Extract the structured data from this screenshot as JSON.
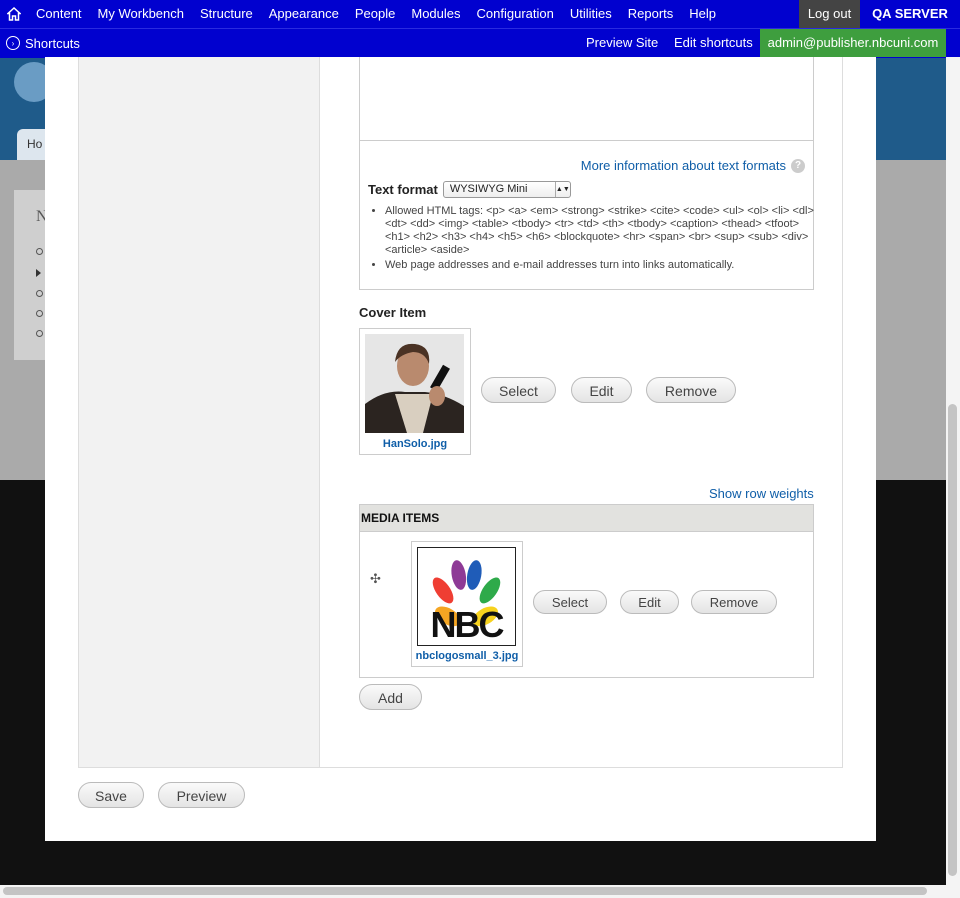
{
  "toolbar": {
    "nav": [
      "Content",
      "My Workbench",
      "Structure",
      "Appearance",
      "People",
      "Modules",
      "Configuration",
      "Utilities",
      "Reports",
      "Help"
    ],
    "logout": "Log out",
    "server": "QA SERVER",
    "shortcuts": "Shortcuts",
    "preview_site": "Preview Site",
    "edit_shortcuts": "Edit shortcuts",
    "user": "admin@publisher.nbcuni.com"
  },
  "background": {
    "tab_partial": "Ho",
    "block_partial": "N"
  },
  "text_format": {
    "more_info": "More information about text formats",
    "help_icon": "?",
    "label": "Text format",
    "selected": "WYSIWYG Mini",
    "tips": [
      "Allowed HTML tags: <p> <a> <em> <strong> <strike> <cite> <code> <ul> <ol> <li> <dl> <dt> <dd> <img> <table> <tbody> <tr> <td> <th> <tbody> <caption> <thead> <tfoot> <h1> <h2> <h3> <h4> <h5> <h6> <blockquote> <hr> <span> <br> <sup> <sub> <div> <article> <aside>",
      "Web page addresses and e-mail addresses turn into links automatically."
    ]
  },
  "cover_item": {
    "label": "Cover Item",
    "filename": "HanSolo.jpg",
    "select": "Select",
    "edit": "Edit",
    "remove": "Remove"
  },
  "media_items": {
    "show_row_weights": "Show row weights",
    "header": "MEDIA ITEMS",
    "rows": [
      {
        "filename": "nbclogosmall_3.jpg",
        "logo_text": "NBC",
        "select": "Select",
        "edit": "Edit",
        "remove": "Remove"
      }
    ],
    "add": "Add"
  },
  "actions": {
    "save": "Save",
    "preview": "Preview"
  },
  "colors": {
    "toolbar": "#0101cf",
    "user_bg": "#3e9e3e",
    "link": "#0f5ea8"
  }
}
